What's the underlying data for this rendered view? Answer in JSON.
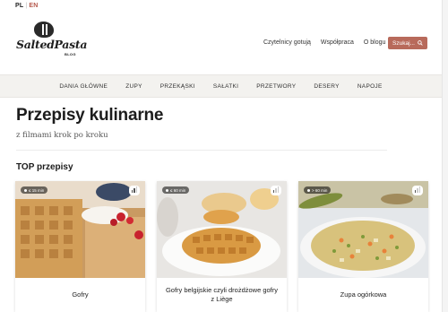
{
  "header": {
    "lang_pl": "PL",
    "lang_sep": "|",
    "lang_en": "EN",
    "logo_text": "SaltedPasta",
    "logo_sub": "BLOG",
    "nav": [
      "Czytelnicy gotują",
      "Współpraca",
      "O blogu"
    ],
    "search_label": "Szukaj..."
  },
  "categories": [
    "DANIA GŁÓWNE",
    "ZUPY",
    "PRZEKĄSKI",
    "SAŁATKI",
    "PRZETWORY",
    "DESERY",
    "NAPOJE"
  ],
  "main": {
    "title": "Przepisy kulinarne",
    "subtitle": "z filmami krok po kroku",
    "top_heading": "TOP przepisy"
  },
  "cards": [
    {
      "time": "≤ 15 min",
      "title": "Gofry",
      "image": "waffles-with-strawberries"
    },
    {
      "time": "≤ 60 min",
      "title": "Gofry belgijskie czyli drożdżowe gofry z Liège",
      "image": "belgian-waffle-plate"
    },
    {
      "time": "> 60 min",
      "title": "Zupa ogórkowa",
      "image": "cucumber-soup-bowl"
    }
  ],
  "colors": {
    "accent": "#b86a5b",
    "category_bar": "#f3f2ef"
  }
}
